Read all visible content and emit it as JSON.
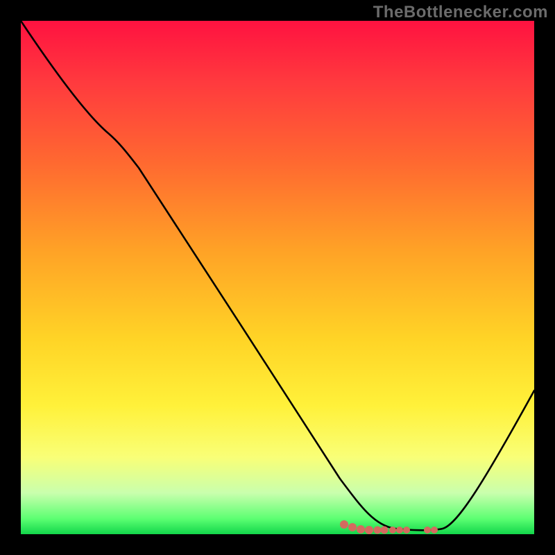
{
  "watermark": "TheBottlenecker.com",
  "chart_data": {
    "type": "line",
    "title": "",
    "xlabel": "",
    "ylabel": "",
    "xlim": [
      0,
      100
    ],
    "ylim": [
      0,
      100
    ],
    "grid": false,
    "series": [
      {
        "name": "curve",
        "x": [
          0,
          15,
          17,
          20,
          30,
          40,
          50,
          60,
          65,
          72,
          82,
          100
        ],
        "values": [
          100,
          80,
          78,
          74,
          58,
          43,
          29,
          14,
          6,
          1,
          1,
          28
        ]
      }
    ],
    "markers": {
      "name": "bottom-dots",
      "color": "#d46a5f",
      "x": [
        63,
        64,
        65,
        66,
        67,
        68,
        70,
        71,
        72,
        77,
        78
      ],
      "values": [
        1.8,
        1.5,
        1.2,
        1.0,
        1.0,
        1.0,
        1.0,
        1.0,
        1.0,
        1.0,
        1.0
      ]
    },
    "background_gradient": {
      "top": "#ff1240",
      "upper_mid": "#ffa326",
      "lower_mid": "#fff13a",
      "bottom": "#12d64a"
    }
  }
}
